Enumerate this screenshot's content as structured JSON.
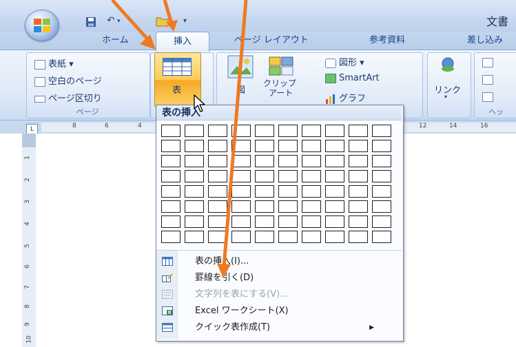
{
  "window": {
    "title": "文書"
  },
  "tabs": [
    {
      "label": "ホーム",
      "active": false
    },
    {
      "label": "挿入",
      "active": true
    },
    {
      "label": "ページ レイアウト",
      "active": false
    },
    {
      "label": "参考資料",
      "active": false
    },
    {
      "label": "差し込み",
      "active": false
    }
  ],
  "ribbon": {
    "pages_group": {
      "items": [
        "表紙 ▾",
        "空白のページ",
        "ページ区切り"
      ],
      "label": "ページ"
    },
    "table_group": {
      "button_label": "表"
    },
    "illustrations_group": {
      "picture_label": "図",
      "clipart_label_line1": "クリップ",
      "clipart_label_line2": "アート",
      "shapes_label": "図形 ▾",
      "smartart_label": "SmartArt",
      "chart_label": "グラフ"
    },
    "links_group": {
      "label": "リンク"
    },
    "header_group": {
      "label": "ヘッ"
    }
  },
  "ruler": {
    "corner": "L",
    "ticks": [
      "8",
      "6",
      "4",
      "12",
      "14",
      "16"
    ],
    "vticks": [
      "1",
      "2",
      "3",
      "4",
      "5",
      "6",
      "7",
      "8",
      "9",
      "10"
    ]
  },
  "dropdown": {
    "header": "表の挿入",
    "grid": {
      "rows": 8,
      "cols": 10
    },
    "menu_items": [
      {
        "label": "表の挿入(I)...",
        "disabled": false,
        "icon": "insert-table-icon"
      },
      {
        "label": "罫線を引く(D)",
        "disabled": false,
        "icon": "draw-table-icon"
      },
      {
        "label": "文字列を表にする(V)...",
        "disabled": true,
        "icon": "convert-text-icon"
      },
      {
        "label": "Excel ワークシート(X)",
        "disabled": false,
        "icon": "excel-sheet-icon"
      },
      {
        "label": "クイック表作成(T)",
        "disabled": false,
        "icon": "quick-table-icon",
        "submenu": true
      }
    ]
  },
  "colors": {
    "annotation_arrow": "#ee7a22",
    "highlight": "#f8b940",
    "ribbon": "#dce7f7"
  }
}
